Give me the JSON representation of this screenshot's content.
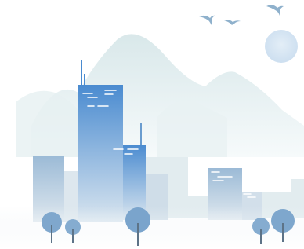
{
  "scene": {
    "colors": {
      "background": "#ffffff",
      "mountain": "#e3eef0",
      "mountain_light": "#edf4f5",
      "sun": "#dce9f4",
      "bird": "#8fb4cf",
      "building_top": "#4c8ccf",
      "building_bottom": "#d6e3ee",
      "window": "#ffffff",
      "tree_crown": "#7ea8cf",
      "tree_trunk": "#6b8296"
    },
    "elements": {
      "illustration": "city-skyline-illustration",
      "birds": "bird-icons",
      "sun": "sun-icon",
      "trees": "tree-icons"
    }
  }
}
